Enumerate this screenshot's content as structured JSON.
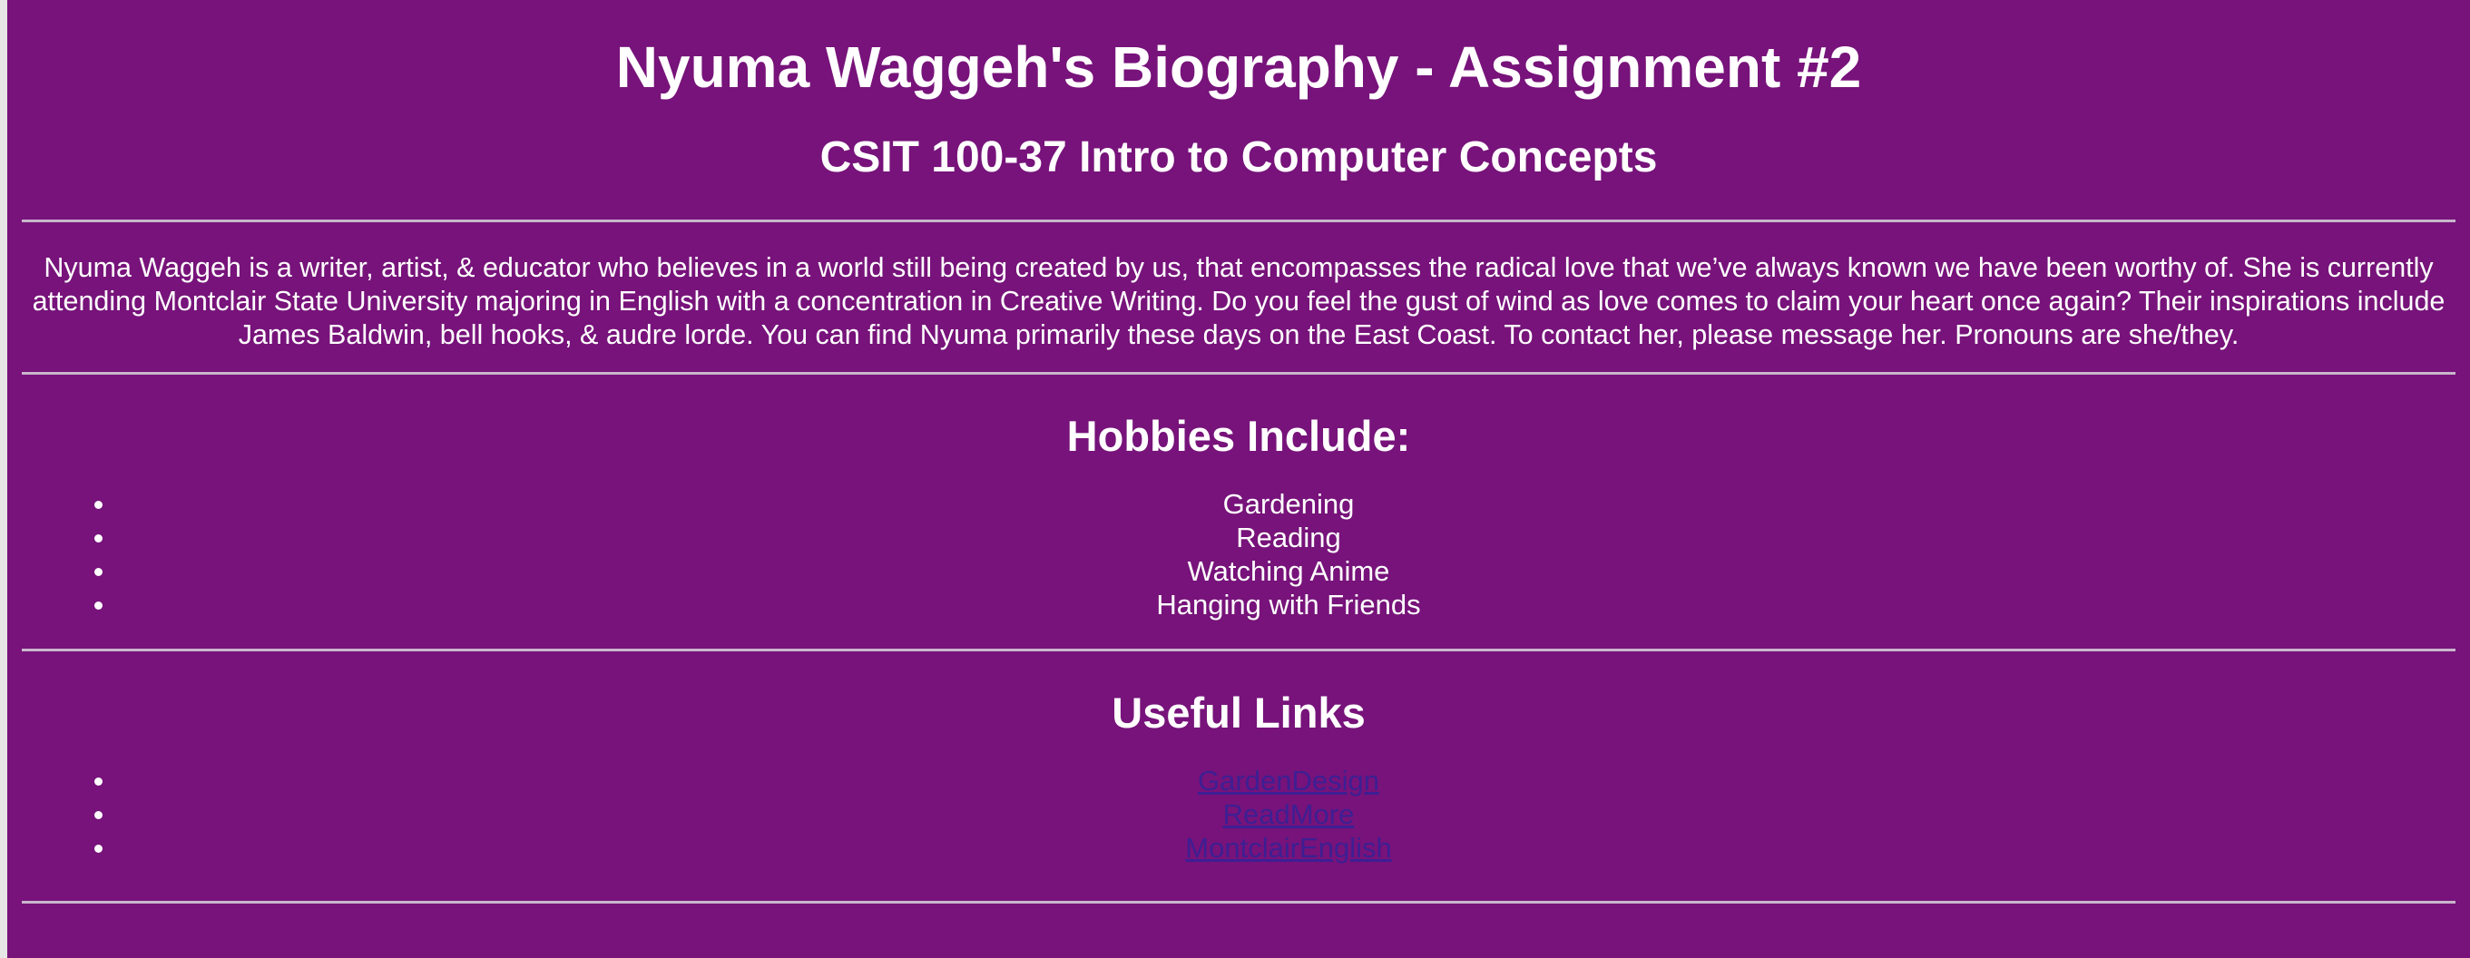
{
  "page": {
    "title": "Nyuma Waggeh's Biography - Assignment #2",
    "subtitle": "CSIT 100-37 Intro to Computer Concepts",
    "bio": "Nyuma Waggeh is a writer, artist, & educator who believes in a world still being created by us, that encompasses the radical love that we’ve always known we have been worthy of. She is currently attending Montclair State University majoring in English with a concentration in Creative Writing. Do you feel the gust of wind as love comes to claim your heart once again? Their inspirations include James Baldwin, bell hooks, & audre lorde. You can find Nyuma primarily these days on the East Coast. To contact her, please message her. Pronouns are she/they."
  },
  "hobbies": {
    "title": "Hobbies Include:",
    "items": [
      "Gardening",
      "Reading",
      "Watching Anime",
      "Hanging with Friends"
    ]
  },
  "links": {
    "title": "Useful Links",
    "items": [
      "GardenDesign",
      "ReadMore",
      "MontclairEnglish"
    ]
  },
  "colors": {
    "background": "#77137a",
    "text": "#ffffff",
    "link": "#3d1f93",
    "rule": "#c9b6cc"
  }
}
